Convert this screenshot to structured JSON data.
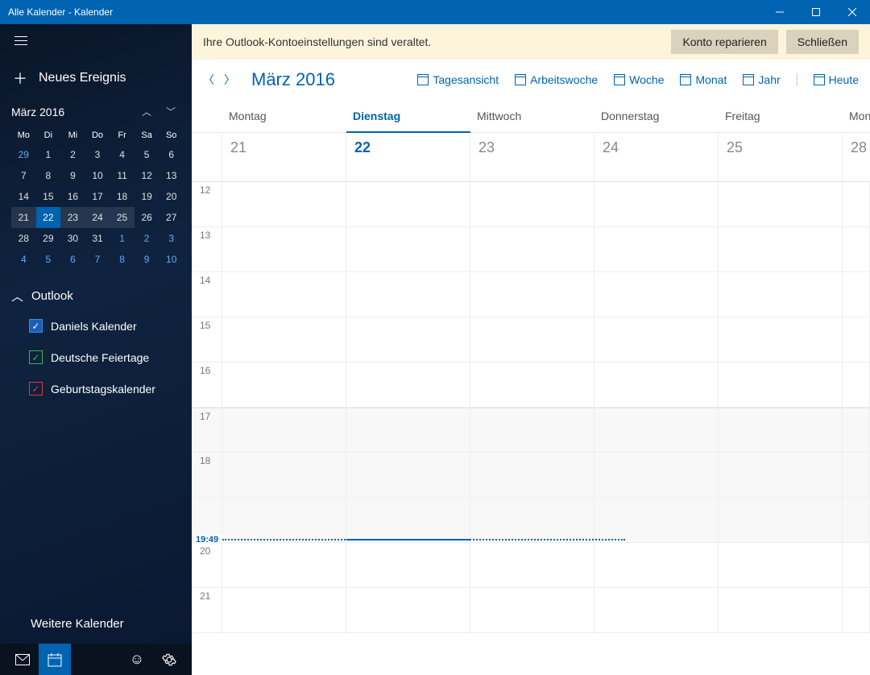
{
  "window": {
    "title": "Alle Kalender - Kalender"
  },
  "sidebar": {
    "new_event": "Neues Ereignis",
    "mini_month": "März 2016",
    "mini_days": [
      "Mo",
      "Di",
      "Mi",
      "Do",
      "Fr",
      "Sa",
      "So"
    ],
    "section_title": "Outlook",
    "calendars": [
      {
        "label": "Daniels Kalender"
      },
      {
        "label": "Deutsche Feiertage"
      },
      {
        "label": "Geburtstagskalender"
      }
    ],
    "more": "Weitere Kalender"
  },
  "notification": {
    "message": "Ihre Outlook-Kontoeinstellungen sind veraltet.",
    "repair": "Konto reparieren",
    "close": "Schließen"
  },
  "topbar": {
    "month": "März 2016",
    "views": {
      "day": "Tagesansicht",
      "work": "Arbeitswoche",
      "week": "Woche",
      "month": "Monat",
      "year": "Jahr",
      "today": "Heute"
    }
  },
  "days": {
    "headers": [
      "Montag",
      "Dienstag",
      "Mittwoch",
      "Donnerstag",
      "Freitag",
      "Mon"
    ],
    "numbers": [
      "21",
      "22",
      "23",
      "24",
      "25",
      "28"
    ]
  },
  "hours": [
    "12",
    "13",
    "14",
    "15",
    "16",
    "17",
    "18",
    "",
    "20",
    "21"
  ],
  "now": "19:49",
  "mini_cells": [
    {
      "t": "29",
      "c": "blue"
    },
    {
      "t": "1",
      "c": ""
    },
    {
      "t": "2",
      "c": ""
    },
    {
      "t": "3",
      "c": ""
    },
    {
      "t": "4",
      "c": ""
    },
    {
      "t": "5",
      "c": ""
    },
    {
      "t": "6",
      "c": ""
    },
    {
      "t": "7",
      "c": ""
    },
    {
      "t": "8",
      "c": ""
    },
    {
      "t": "9",
      "c": ""
    },
    {
      "t": "10",
      "c": ""
    },
    {
      "t": "11",
      "c": ""
    },
    {
      "t": "12",
      "c": ""
    },
    {
      "t": "13",
      "c": ""
    },
    {
      "t": "14",
      "c": ""
    },
    {
      "t": "15",
      "c": ""
    },
    {
      "t": "16",
      "c": ""
    },
    {
      "t": "17",
      "c": ""
    },
    {
      "t": "18",
      "c": ""
    },
    {
      "t": "19",
      "c": ""
    },
    {
      "t": "20",
      "c": ""
    },
    {
      "t": "21",
      "c": "weekrow"
    },
    {
      "t": "22",
      "c": "today"
    },
    {
      "t": "23",
      "c": "weekrow"
    },
    {
      "t": "24",
      "c": "weekrow"
    },
    {
      "t": "25",
      "c": "weekrow"
    },
    {
      "t": "26",
      "c": ""
    },
    {
      "t": "27",
      "c": ""
    },
    {
      "t": "28",
      "c": ""
    },
    {
      "t": "29",
      "c": ""
    },
    {
      "t": "30",
      "c": ""
    },
    {
      "t": "31",
      "c": ""
    },
    {
      "t": "1",
      "c": "blue"
    },
    {
      "t": "2",
      "c": "blue"
    },
    {
      "t": "3",
      "c": "blue"
    },
    {
      "t": "4",
      "c": "blue"
    },
    {
      "t": "5",
      "c": "blue"
    },
    {
      "t": "6",
      "c": "blue"
    },
    {
      "t": "7",
      "c": "blue"
    },
    {
      "t": "8",
      "c": "blue"
    },
    {
      "t": "9",
      "c": "blue"
    },
    {
      "t": "10",
      "c": "blue"
    }
  ]
}
